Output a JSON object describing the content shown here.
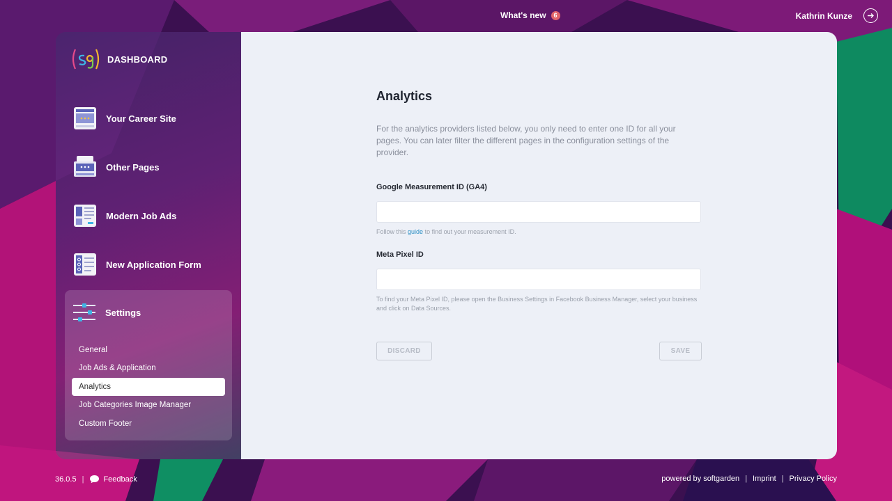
{
  "header": {
    "whats_new": "What's new",
    "whats_new_count": "6",
    "user_name": "Kathrin Kunze"
  },
  "sidebar": {
    "brand": "DASHBOARD",
    "items": [
      {
        "label": "Your Career Site",
        "icon": "career-site-icon"
      },
      {
        "label": "Other Pages",
        "icon": "other-pages-icon"
      },
      {
        "label": "Modern Job Ads",
        "icon": "job-ads-icon"
      },
      {
        "label": "New Application Form",
        "icon": "application-form-icon"
      }
    ],
    "settings": {
      "label": "Settings",
      "sub_items": [
        {
          "label": "General",
          "active": false
        },
        {
          "label": "Job Ads & Application",
          "active": false
        },
        {
          "label": "Analytics",
          "active": true
        },
        {
          "label": "Job Categories Image Manager",
          "active": false
        },
        {
          "label": "Custom Footer",
          "active": false
        }
      ]
    }
  },
  "main": {
    "title": "Analytics",
    "intro": "For the analytics providers listed below, you only need to enter one ID for all your pages. You can later filter the different pages in the configuration settings of the provider.",
    "fields": {
      "ga4": {
        "label": "Google Measurement ID (GA4)",
        "value": "",
        "help_before": "Follow this",
        "help_link": "guide",
        "help_after": "to find out your measurement ID."
      },
      "meta": {
        "label": "Meta Pixel ID",
        "value": "",
        "help": "To find your Meta Pixel ID, please open the Business Settings in Facebook Business Manager, select your business and click on Data Sources."
      }
    },
    "buttons": {
      "discard": "DISCARD",
      "save": "SAVE"
    }
  },
  "footer": {
    "version": "36.0.5",
    "feedback": "Feedback",
    "powered_by": "powered by softgarden",
    "imprint": "Imprint",
    "privacy": "Privacy Policy"
  },
  "colors": {
    "panel_bg": "#edf0f7",
    "link": "#2a8fc4",
    "badge": "#e2646a"
  }
}
